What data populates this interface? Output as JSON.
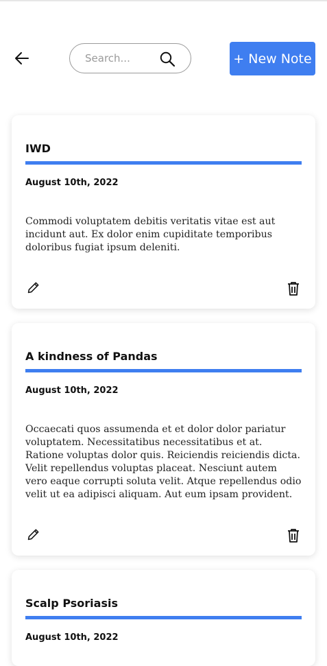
{
  "header": {
    "back_icon": "arrow-left-icon",
    "search": {
      "placeholder": "Search...",
      "value": "",
      "icon": "search-icon"
    },
    "new_note_label": "+ New Note"
  },
  "colors": {
    "accent": "#3f7ef0",
    "text": "#111111",
    "search_border": "#9a9a9a"
  },
  "notes": [
    {
      "title": "IWD",
      "date": "August 10th, 2022",
      "body": "Commodi voluptatem debitis veritatis vitae est aut incidunt aut. Ex dolor enim cupiditate temporibus doloribus fugiat ipsum deleniti.",
      "edit_icon": "pencil-icon",
      "delete_icon": "trash-icon"
    },
    {
      "title": "A kindness of Pandas",
      "date": "August 10th, 2022",
      "body": "Occaecati quos assumenda et et dolor dolor pariatur voluptatem. Necessitatibus necessitatibus et at. Ratione voluptas dolor quis. Reiciendis reiciendis dicta. Velit repellendus voluptas placeat. Nesciunt autem vero eaque corrupti soluta velit. Atque repellendus odio velit ut ea adipisci aliquam. Aut eum ipsam provident.",
      "edit_icon": "pencil-icon",
      "delete_icon": "trash-icon"
    },
    {
      "title": "Scalp Psoriasis",
      "date": "August 10th, 2022"
    }
  ]
}
